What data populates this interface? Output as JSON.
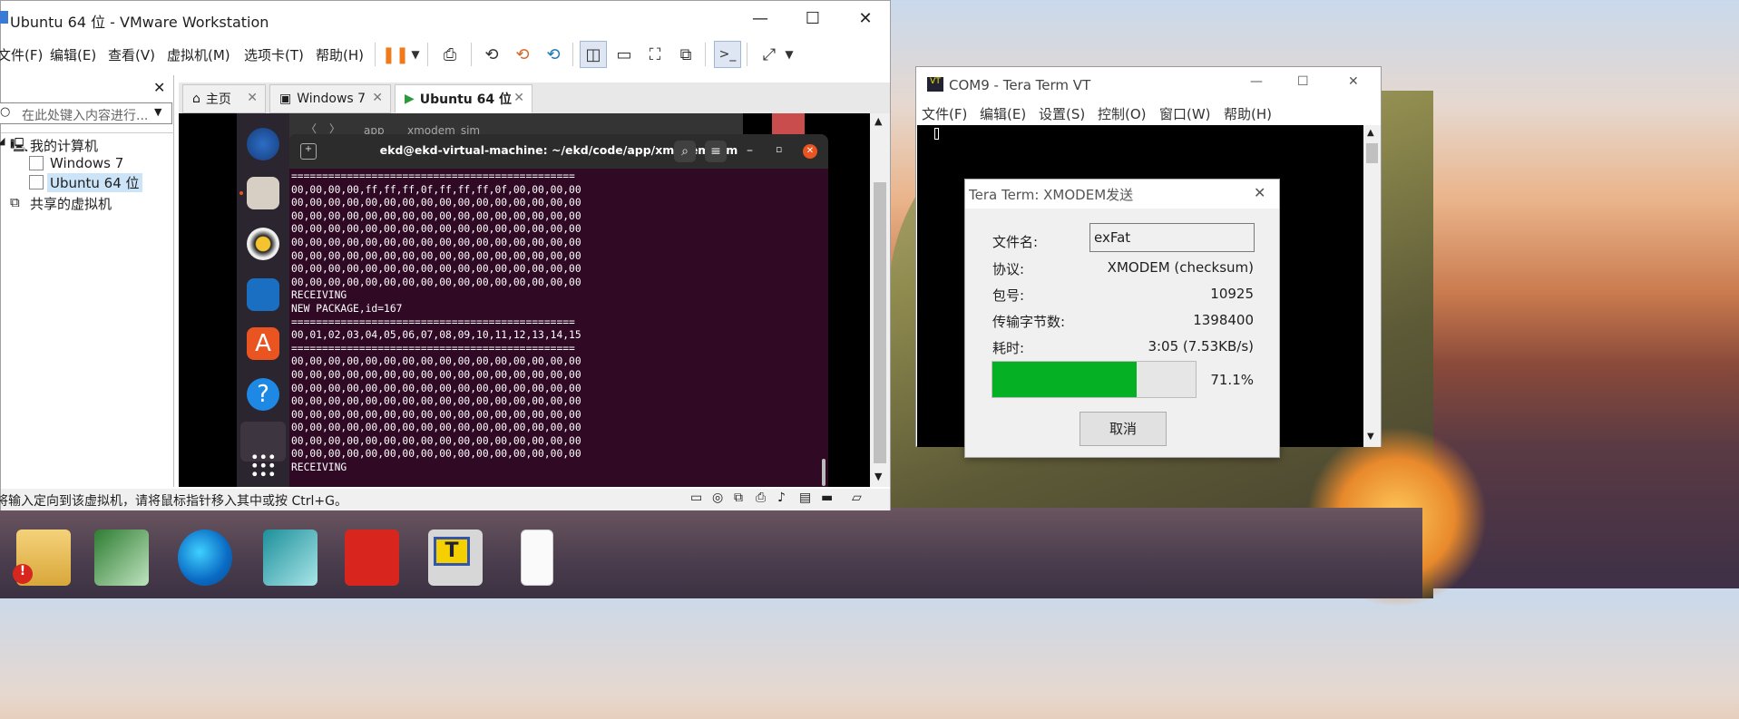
{
  "vmware": {
    "title": "Ubuntu 64 位 - VMware Workstation",
    "menu": [
      "文件(F)",
      "编辑(E)",
      "查看(V)",
      "虚拟机(M)",
      "选项卡(T)",
      "帮助(H)"
    ],
    "library_search_placeholder": "在此处键入内容进行...",
    "tree": {
      "root": "我的计算机",
      "vm1": "Windows 7",
      "vm2": "Ubuntu 64 位",
      "shared": "共享的虚拟机"
    },
    "tabs": [
      "主页",
      "Windows 7",
      "Ubuntu 64 位"
    ],
    "status_text": "将输入定向到该虚拟机，请将鼠标指针移入其中或按 Ctrl+G。"
  },
  "ubuntu": {
    "bg_window": {
      "crumb1": "app",
      "crumb2": "xmodem_sim"
    },
    "terminal_title": "ekd@ekd-virtual-machine: ~/ekd/code/app/xmodem_sim",
    "lines": [
      "==============================================",
      "00,00,00,00,ff,ff,ff,0f,ff,ff,ff,0f,00,00,00,00",
      "00,00,00,00,00,00,00,00,00,00,00,00,00,00,00,00",
      "00,00,00,00,00,00,00,00,00,00,00,00,00,00,00,00",
      "00,00,00,00,00,00,00,00,00,00,00,00,00,00,00,00",
      "00,00,00,00,00,00,00,00,00,00,00,00,00,00,00,00",
      "00,00,00,00,00,00,00,00,00,00,00,00,00,00,00,00",
      "00,00,00,00,00,00,00,00,00,00,00,00,00,00,00,00",
      "00,00,00,00,00,00,00,00,00,00,00,00,00,00,00,00",
      "RECEIVING",
      "NEW PACKAGE,id=167",
      "==============================================",
      "00,01,02,03,04,05,06,07,08,09,10,11,12,13,14,15",
      "==============================================",
      "00,00,00,00,00,00,00,00,00,00,00,00,00,00,00,00",
      "00,00,00,00,00,00,00,00,00,00,00,00,00,00,00,00",
      "00,00,00,00,00,00,00,00,00,00,00,00,00,00,00,00",
      "00,00,00,00,00,00,00,00,00,00,00,00,00,00,00,00",
      "00,00,00,00,00,00,00,00,00,00,00,00,00,00,00,00",
      "00,00,00,00,00,00,00,00,00,00,00,00,00,00,00,00",
      "00,00,00,00,00,00,00,00,00,00,00,00,00,00,00,00",
      "00,00,00,00,00,00,00,00,00,00,00,00,00,00,00,00",
      "RECEIVING"
    ]
  },
  "teraterm": {
    "title": "COM9 - Tera Term VT",
    "menu": [
      "文件(F)",
      "编辑(E)",
      "设置(S)",
      "控制(O)",
      "窗口(W)",
      "帮助(H)"
    ],
    "dialog": {
      "title": "Tera Term: XMODEM发送",
      "filename_label": "文件名:",
      "filename": "exFat",
      "protocol_label": "协议:",
      "protocol": "XMODEM (checksum)",
      "packet_label": "包号:",
      "packet": "10925",
      "bytes_label": "传输字节数:",
      "bytes": "1398400",
      "time_label": "耗时:",
      "time": "3:05 (7.53KB/s)",
      "progress_fraction": 0.711,
      "progress_text": "71.1%",
      "cancel_label": "取消"
    }
  },
  "colors": {
    "terminal_bg": "#300a24",
    "progress_green": "#06b025",
    "titlebar_bg": "#ffffff"
  },
  "taskbar_icons": [
    "folder-icon",
    "network-app-icon",
    "edge-icon",
    "3d-app-icon",
    "flag-app-icon",
    "teraterm-icon",
    "document-icon"
  ]
}
